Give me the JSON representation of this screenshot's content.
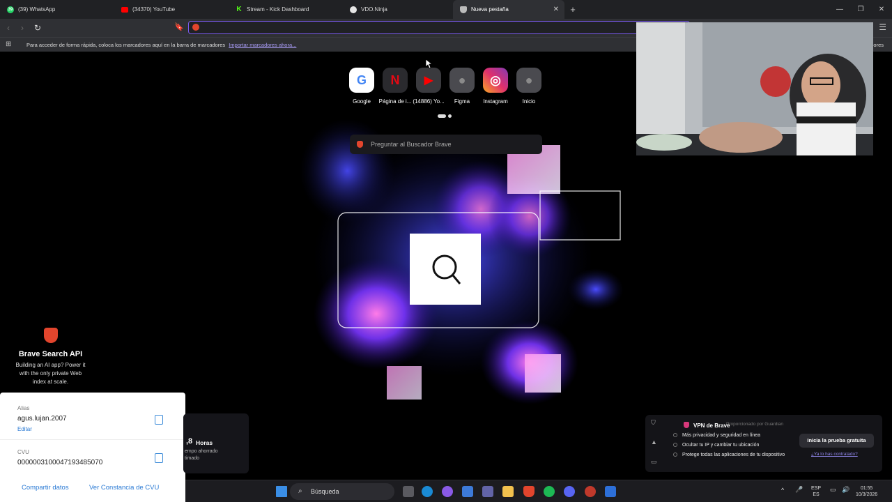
{
  "tabs": [
    {
      "label": "(39) WhatsApp",
      "color": "#25d366",
      "badge": "39"
    },
    {
      "label": "(34370) YouTube",
      "color": "#ff0000",
      "badge": ""
    },
    {
      "label": "Stream - Kick Dashboard",
      "color": "#53fc18",
      "badge": "K"
    },
    {
      "label": "VDO.Ninja",
      "color": "#e5e5e5",
      "badge": ""
    },
    {
      "label": "Nueva pestaña",
      "color": "#bbbbbb",
      "badge": ""
    }
  ],
  "toolbar": {
    "url_value": "",
    "url_placeholder": ""
  },
  "bookmarks_bar": {
    "message": "Para acceder de forma rápida, coloca los marcadores aquí en la barra de marcadores",
    "import_link": "Importar marcadores ahora...",
    "other_partial": "dores"
  },
  "shortcuts": [
    {
      "label": "Google",
      "glyph": "G",
      "icon": "google-icon",
      "color": "#4285f4",
      "bg": "#ffffff"
    },
    {
      "label": "Página de i...",
      "glyph": "N",
      "icon": "netflix-icon",
      "color": "#e50914",
      "bg": "#2a2a2e"
    },
    {
      "label": "(14886) Yo...",
      "glyph": "▶",
      "icon": "youtube-icon",
      "color": "#ffffff",
      "bg": "#ff0000"
    },
    {
      "label": "Figma",
      "glyph": "●",
      "icon": "globe-icon",
      "color": "#9a9a9a",
      "bg": "#4a4a4f"
    },
    {
      "label": "Instagram",
      "glyph": "◎",
      "icon": "instagram-icon",
      "color": "#ffffff",
      "bg": "#c13584"
    },
    {
      "label": "Inicio",
      "glyph": "●",
      "icon": "globe-icon",
      "color": "#9a9a9a",
      "bg": "#4a4a4f"
    }
  ],
  "brave_search": {
    "placeholder": "Preguntar al Buscador Brave"
  },
  "api_promo": {
    "title": "Brave Search API",
    "description": "Building an AI app? Power it with the only private Web index at scale."
  },
  "alias_card": {
    "alias_label": "Alias",
    "alias_value": "agus.lujan.2007",
    "edit_label": "Editar",
    "cvu_label": "CVU",
    "cvu_value": "0000003100047193485070",
    "share_button": "Compartir datos",
    "cvu_button": "Ver Constancia de CVU"
  },
  "time_saved": {
    "number": ",8",
    "unit": "Horas",
    "line1": "empo ahorrado",
    "line2": "timado"
  },
  "vpn": {
    "title": "VPN de Brave",
    "provider": "Proporcionado por Guardian",
    "features": [
      "Más privacidad y seguridad en línea",
      "Ocultar tu IP y cambiar tu ubicación",
      "Protege todas las aplicaciones de tu dispositivo"
    ],
    "cta": "Inicia la prueba gratuita",
    "link": "¿Ya lo has contratado?"
  },
  "taskbar": {
    "search_label": "Búsqueda",
    "lang_top": "ESP",
    "lang_bottom": "ES",
    "time": "01:55",
    "date": "10/3/2026"
  }
}
